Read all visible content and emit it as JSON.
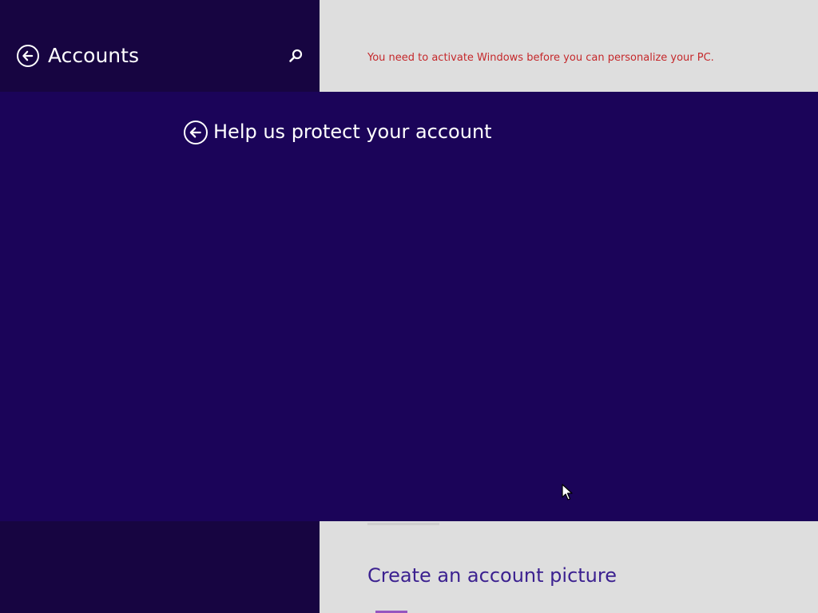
{
  "sidebar": {
    "title": "Accounts",
    "back_icon": "back-arrow-circle-icon",
    "search_icon": "search-icon"
  },
  "content": {
    "activation_warning": "You need to activate Windows before you can personalize your PC.",
    "section_heading": "Create an account picture"
  },
  "dialog": {
    "title": "Help us protect your account",
    "back_icon": "back-arrow-circle-icon"
  },
  "colors": {
    "sidebar_background": "#170541",
    "dialog_background": "#1b0459",
    "content_background": "#dedede",
    "warning_text": "#c5282b",
    "heading_text": "#3c2190"
  }
}
